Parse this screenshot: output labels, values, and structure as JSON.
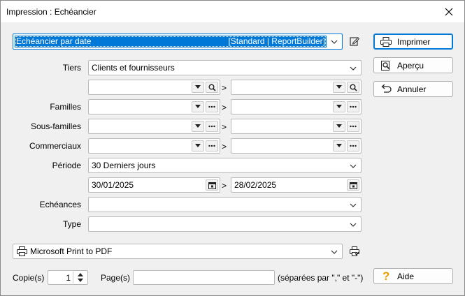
{
  "window": {
    "title": "Impression : Echéancier"
  },
  "report": {
    "name": "Echéancier par date",
    "tag": "[Standard | ReportBuilder]"
  },
  "labels": {
    "tiers": "Tiers",
    "familles": "Familles",
    "sous_familles": "Sous-familles",
    "commerciaux": "Commerciaux",
    "periode": "Période",
    "echeances": "Echéances",
    "type": "Type",
    "copies": "Copie(s)",
    "pages": "Page(s)",
    "pages_hint": "(séparées par \",\" et \"-\")",
    "range_sep": ">"
  },
  "values": {
    "tiers": "Clients et fournisseurs",
    "periode": "30 Derniers jours",
    "date_from": "30/01/2025",
    "date_to": "28/02/2025",
    "printer": "Microsoft Print to PDF",
    "copies": "1",
    "pages": ""
  },
  "buttons": {
    "imprimer": "Imprimer",
    "apercu": "Aperçu",
    "annuler": "Annuler",
    "aide": "Aide"
  },
  "icons": [
    "close-icon",
    "chevron-down-icon",
    "edit-report-icon",
    "search-icon",
    "ellipsis-icon",
    "calendar-icon",
    "printer-icon",
    "preview-icon",
    "undo-icon",
    "help-icon",
    "printer-setup-icon",
    "spin-up-icon",
    "spin-down-icon"
  ],
  "colors": {
    "accent": "#0078d7",
    "help": "#e8a000"
  }
}
